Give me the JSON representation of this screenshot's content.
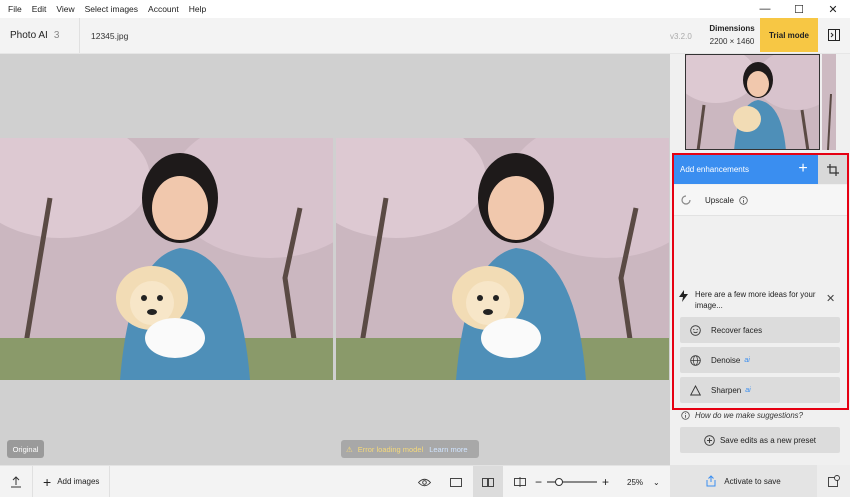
{
  "menu": [
    "File",
    "Edit",
    "View",
    "Select images",
    "Account",
    "Help"
  ],
  "window_controls": {
    "minimize": "—",
    "maximize": "☐",
    "close": "✕"
  },
  "header": {
    "app_title": "Photo AI",
    "image_count": "3",
    "file_name": "12345.jpg",
    "version": "v3.2.0",
    "dimensions_label": "Dimensions",
    "dimensions_value": "2200 × 1460",
    "trial_label": "Trial mode"
  },
  "canvas": {
    "original_badge": "Original",
    "error_text": "Error loading model",
    "learn_more": "Learn more"
  },
  "panel": {
    "add_enhancements": "Add enhancements",
    "upscale_label": "Upscale",
    "ideas_text": "Here are a few more ideas for your image...",
    "ideas": [
      {
        "label": "Recover faces",
        "ai": ""
      },
      {
        "label": "Denoise",
        "ai": "ai"
      },
      {
        "label": "Sharpen",
        "ai": "ai"
      }
    ],
    "how_link": "How do we make suggestions?",
    "save_preset": "Save edits as a new preset"
  },
  "bottom": {
    "add_images": "Add images",
    "zoom": "25%",
    "activate": "Activate to save"
  },
  "colors": {
    "accent": "#3a8ef0",
    "trial": "#f7c744",
    "highlight_box": "#e60012"
  }
}
